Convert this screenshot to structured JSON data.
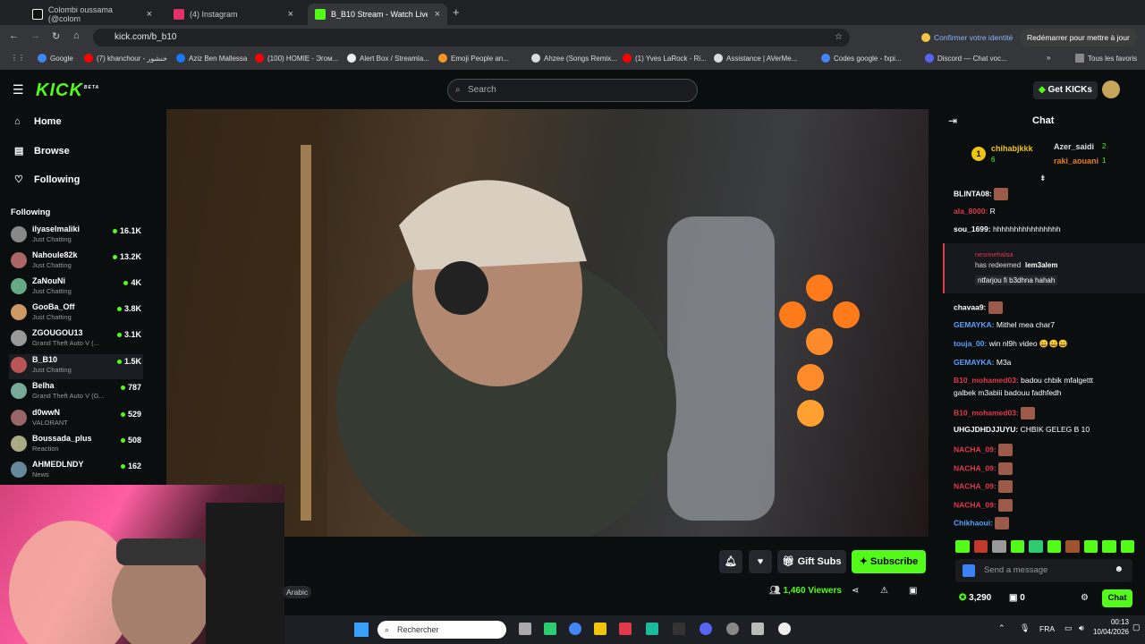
{
  "browser": {
    "tabs": [
      {
        "label": "Colombi oussama (@colom",
        "active": false
      },
      {
        "label": "(4) Instagram",
        "active": false
      },
      {
        "label": "B_B10 Stream - Watch Live on K",
        "active": true
      }
    ],
    "url": "kick.com/b_b10",
    "profile_prompt": "Confirmer votre identité",
    "restart_prompt": "Redémarrer pour mettre à jour",
    "bookmarks": [
      "Google",
      "(7) khanchour - خنشور",
      "Aziz Ben Mallessa",
      "(100) HOMIE - Эгом...",
      "Alert Box / Streamla...",
      "Emoji People an...",
      "Ahzee (Songs Remix...",
      "(1) Yves LaRock - Ri...",
      "Assistance | AVerMe...",
      "Codes google - fxpi...",
      "Discord — Chat voc..."
    ],
    "all_bookmarks": "Tous les favoris"
  },
  "header": {
    "logo": "KICK",
    "logo_badge": "BETA",
    "search_placeholder": "Search",
    "get_kicks": "Get KICKs"
  },
  "sidebar": {
    "nav": [
      "Home",
      "Browse",
      "Following"
    ],
    "following_title": "Following",
    "channels": [
      {
        "name": "ilyaselmaliki",
        "category": "Just Chatting",
        "viewers": "16.1K"
      },
      {
        "name": "Nahoule82k",
        "category": "Just Chatting",
        "viewers": "13.2K"
      },
      {
        "name": "ZaNouNi",
        "category": "Just Chatting",
        "viewers": "4K"
      },
      {
        "name": "GooBa_Off",
        "category": "Just Chatting",
        "viewers": "3.8K"
      },
      {
        "name": "ZGOUGOU13",
        "category": "Grand Theft Auto V (...",
        "viewers": "3.1K"
      },
      {
        "name": "B_B10",
        "category": "Just Chatting",
        "viewers": "1.5K"
      },
      {
        "name": "Belha",
        "category": "Grand Theft Auto V (G...",
        "viewers": "787"
      },
      {
        "name": "d0wwN",
        "category": "VALORANT",
        "viewers": "529"
      },
      {
        "name": "Boussada_plus",
        "category": "Reaction",
        "viewers": "508"
      },
      {
        "name": "AHMEDLNDY",
        "category": "News",
        "viewers": "162"
      }
    ]
  },
  "stream": {
    "tag": "Arabic",
    "gift_subs": "Gift Subs",
    "subscribe": "Subscribe",
    "viewers": "1,460 Viewers"
  },
  "chat": {
    "title": "Chat",
    "leaders": [
      {
        "name": "chihabjkkk",
        "count": "6"
      },
      {
        "name": "Azer_saidi",
        "count": "2"
      },
      {
        "name": "raki_aouani",
        "count": "1"
      }
    ],
    "messages": [
      {
        "user": "BLINTA08:",
        "text": "",
        "color": "#ffffff"
      },
      {
        "user": "ala_8000:",
        "text": "R",
        "color": "#e0394b"
      },
      {
        "user": "sou_1699:",
        "text": "hhhhhhhhhhhhhhhh",
        "color": "#ffffff"
      },
      {
        "user": "chavaa9:",
        "text": "",
        "color": "#ffffff"
      },
      {
        "user": "GEMAYKA:",
        "text": "Mithel mea char7",
        "color": "#5aa0ff"
      },
      {
        "user": "touja_00:",
        "text": "win nl9h video 😀😀😀",
        "color": "#5aa0ff"
      },
      {
        "user": "GEMAYKA:",
        "text": "M3a",
        "color": "#5aa0ff"
      },
      {
        "user": "B10_mohamed03:",
        "text": "badou chbik mfalgettt",
        "color": "#e0394b"
      },
      {
        "user": "",
        "text": "galbek m3abiii badouu fadhfedh",
        "color": "#ffffff"
      },
      {
        "user": "B10_mohamed03:",
        "text": "",
        "color": "#e0394b"
      },
      {
        "user": "UHGJDHDJJUYU:",
        "text": "CHBIK GELEG B 10",
        "color": "#ffffff"
      },
      {
        "user": "NACHA_09:",
        "text": "",
        "color": "#e0394b"
      },
      {
        "user": "NACHA_09:",
        "text": "",
        "color": "#e0394b"
      },
      {
        "user": "NACHA_09:",
        "text": "",
        "color": "#e0394b"
      },
      {
        "user": "NACHA_09:",
        "text": "",
        "color": "#e0394b"
      },
      {
        "user": "Chikhaoui:",
        "text": "",
        "color": "#5aa0ff"
      }
    ],
    "redeem": {
      "user": "nesrinehalsa",
      "action": "has redeemed",
      "reward": "lem3alem",
      "message": "ntfarjou fi b3dhna hahah"
    },
    "input_placeholder": "Send a message",
    "points": "3,290",
    "zero": "0",
    "send": "Chat"
  },
  "taskbar": {
    "search": "Rechercher",
    "lang": "FRA",
    "time": "00:13",
    "date": "10/04/2026"
  }
}
